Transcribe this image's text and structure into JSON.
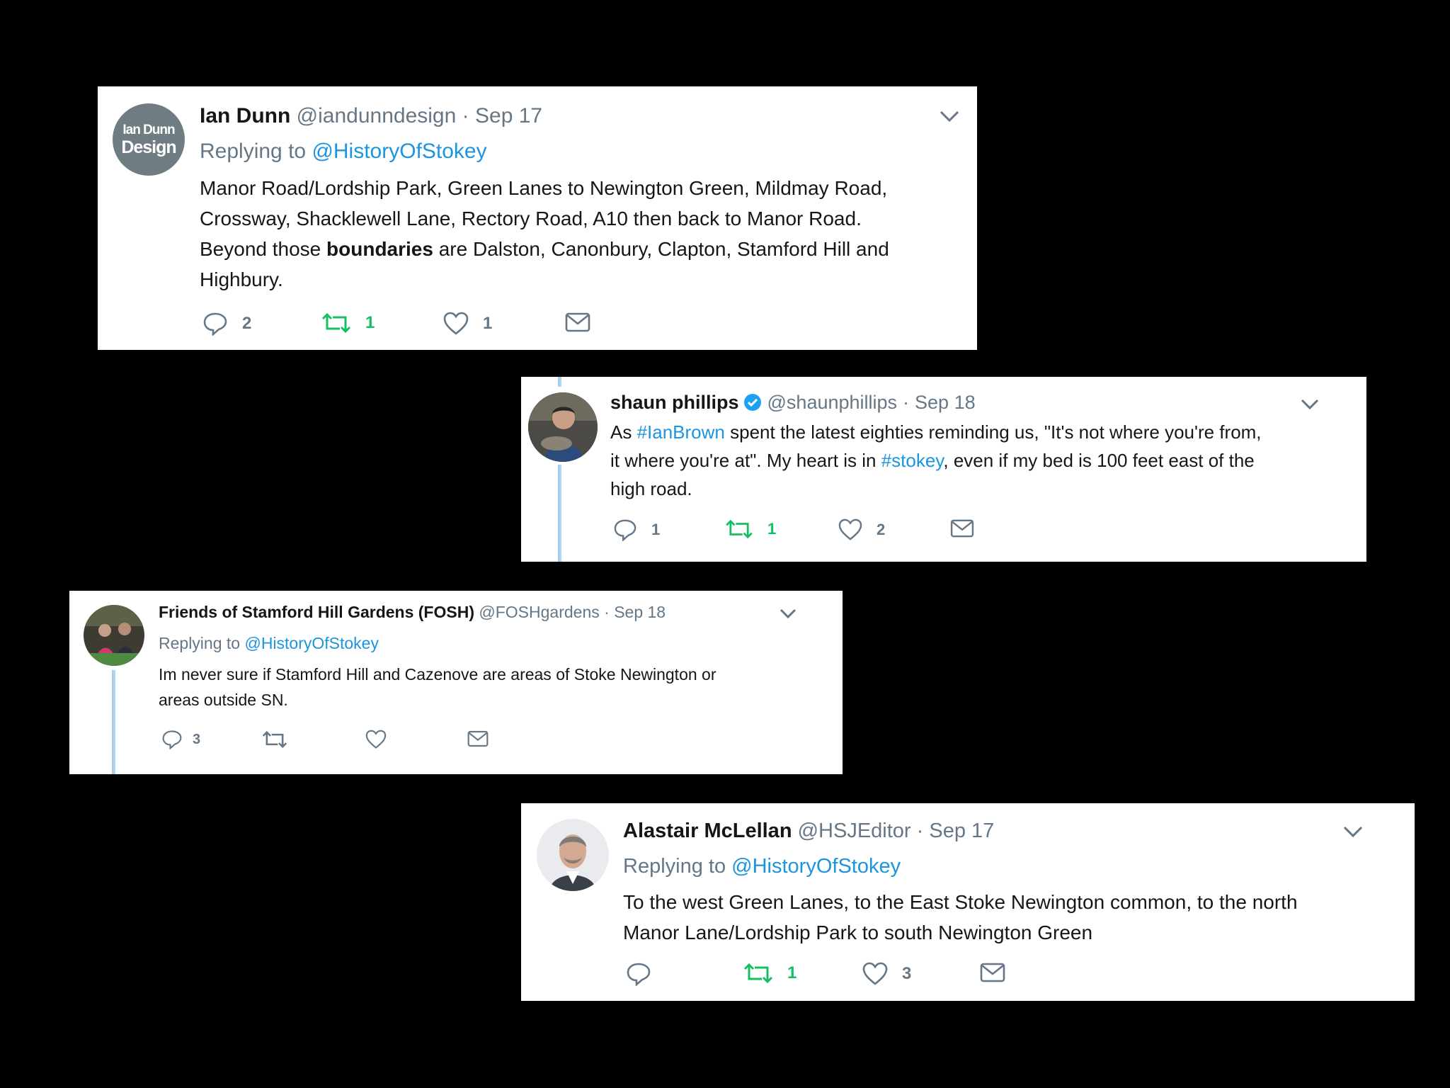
{
  "tweets": [
    {
      "name": "Ian Dunn",
      "handle": "@iandunndesign",
      "sep": "·",
      "date": "Sep 17",
      "replying_prefix": "Replying to",
      "replying_to": "@HistoryOfStokey",
      "avatar_text_1": "Ian Dunn",
      "avatar_text_2": "Design",
      "text_1": "Manor Road/Lordship Park, Green Lanes to Newington Green, Mildmay Road,",
      "text_2": "Crossway, Shacklewell Lane, Rectory Road, A10 then back to Manor Road.",
      "text_3a": "Beyond those ",
      "text_3b": "boundaries",
      "text_3c": " are Dalston, Canonbury, Clapton, Stamford Hill and",
      "text_4": "Highbury.",
      "replies": "2",
      "retweets": "1",
      "likes": "1",
      "retweeted": true
    },
    {
      "name": "shaun phillips",
      "verified": true,
      "handle": "@shaunphillips",
      "sep": "·",
      "date": "Sep 18",
      "text_1a": "As ",
      "text_1b": "#IanBrown",
      "text_1c": " spent the latest eighties reminding us, \"It's not where you're from,",
      "text_2a": "it where you're at\". My heart is in ",
      "text_2b": "#stokey",
      "text_2c": ", even if my bed is 100 feet east of the",
      "text_3": "high road.",
      "replies": "1",
      "retweets": "1",
      "likes": "2",
      "retweeted": true
    },
    {
      "name": "Friends of Stamford Hill Gardens (FOSH)",
      "handle": "@FOSHgardens",
      "sep": "·",
      "date": "Sep 18",
      "replying_prefix": "Replying to",
      "replying_to": "@HistoryOfStokey",
      "text_1": "Im never sure if Stamford Hill and Cazenove are areas of Stoke Newington or",
      "text_2": "areas outside SN.",
      "replies": "3",
      "retweets": "",
      "likes": ""
    },
    {
      "name": "Alastair McLellan",
      "handle": "@HSJEditor",
      "sep": "·",
      "date": "Sep 17",
      "replying_prefix": "Replying to",
      "replying_to": "@HistoryOfStokey",
      "text_1": "To the west Green Lanes, to the East Stoke Newington common, to the north",
      "text_2": "Manor Lane/Lordship Park to south Newington Green",
      "replies": "",
      "retweets": "1",
      "likes": "3",
      "retweeted": true
    }
  ],
  "colors": {
    "link": "#1b95e0",
    "muted": "#657786",
    "retweet_active": "#17bf63",
    "background": "#000000",
    "card": "#ffffff"
  },
  "icons": [
    "reply-icon",
    "retweet-icon",
    "like-icon",
    "dm-icon",
    "chevron-down-icon",
    "verified-badge-icon"
  ]
}
